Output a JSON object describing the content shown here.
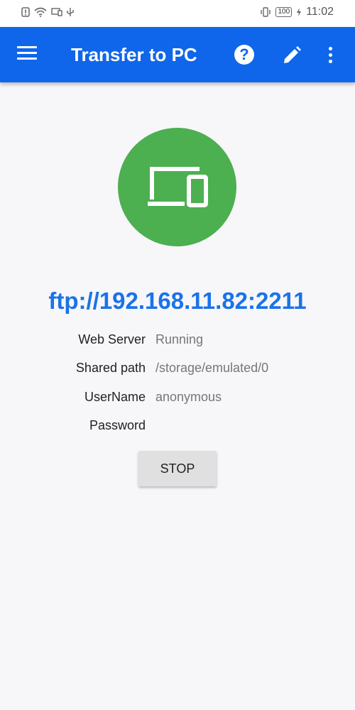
{
  "status_bar": {
    "time": "11:02",
    "battery": "100",
    "left_icons": [
      "alert-icon",
      "wifi-icon",
      "cast-icon",
      "usb-icon"
    ],
    "right_icons": [
      "vibrate-icon",
      "battery-icon",
      "charging-icon"
    ]
  },
  "app_bar": {
    "title": "Transfer to PC",
    "background": "#0f66ea",
    "actions": [
      "help-icon",
      "edit-icon",
      "more-options-icon"
    ]
  },
  "hero": {
    "icon": "devices-icon",
    "color": "#4caf50"
  },
  "ftp_url": "ftp://192.168.11.82:2211",
  "info": {
    "web_server_label": "Web Server",
    "web_server_value": "Running",
    "shared_path_label": "Shared path",
    "shared_path_value": "/storage/emulated/0",
    "username_label": "UserName",
    "username_value": "anonymous",
    "password_label": "Password",
    "password_value": ""
  },
  "stop_button": "STOP"
}
